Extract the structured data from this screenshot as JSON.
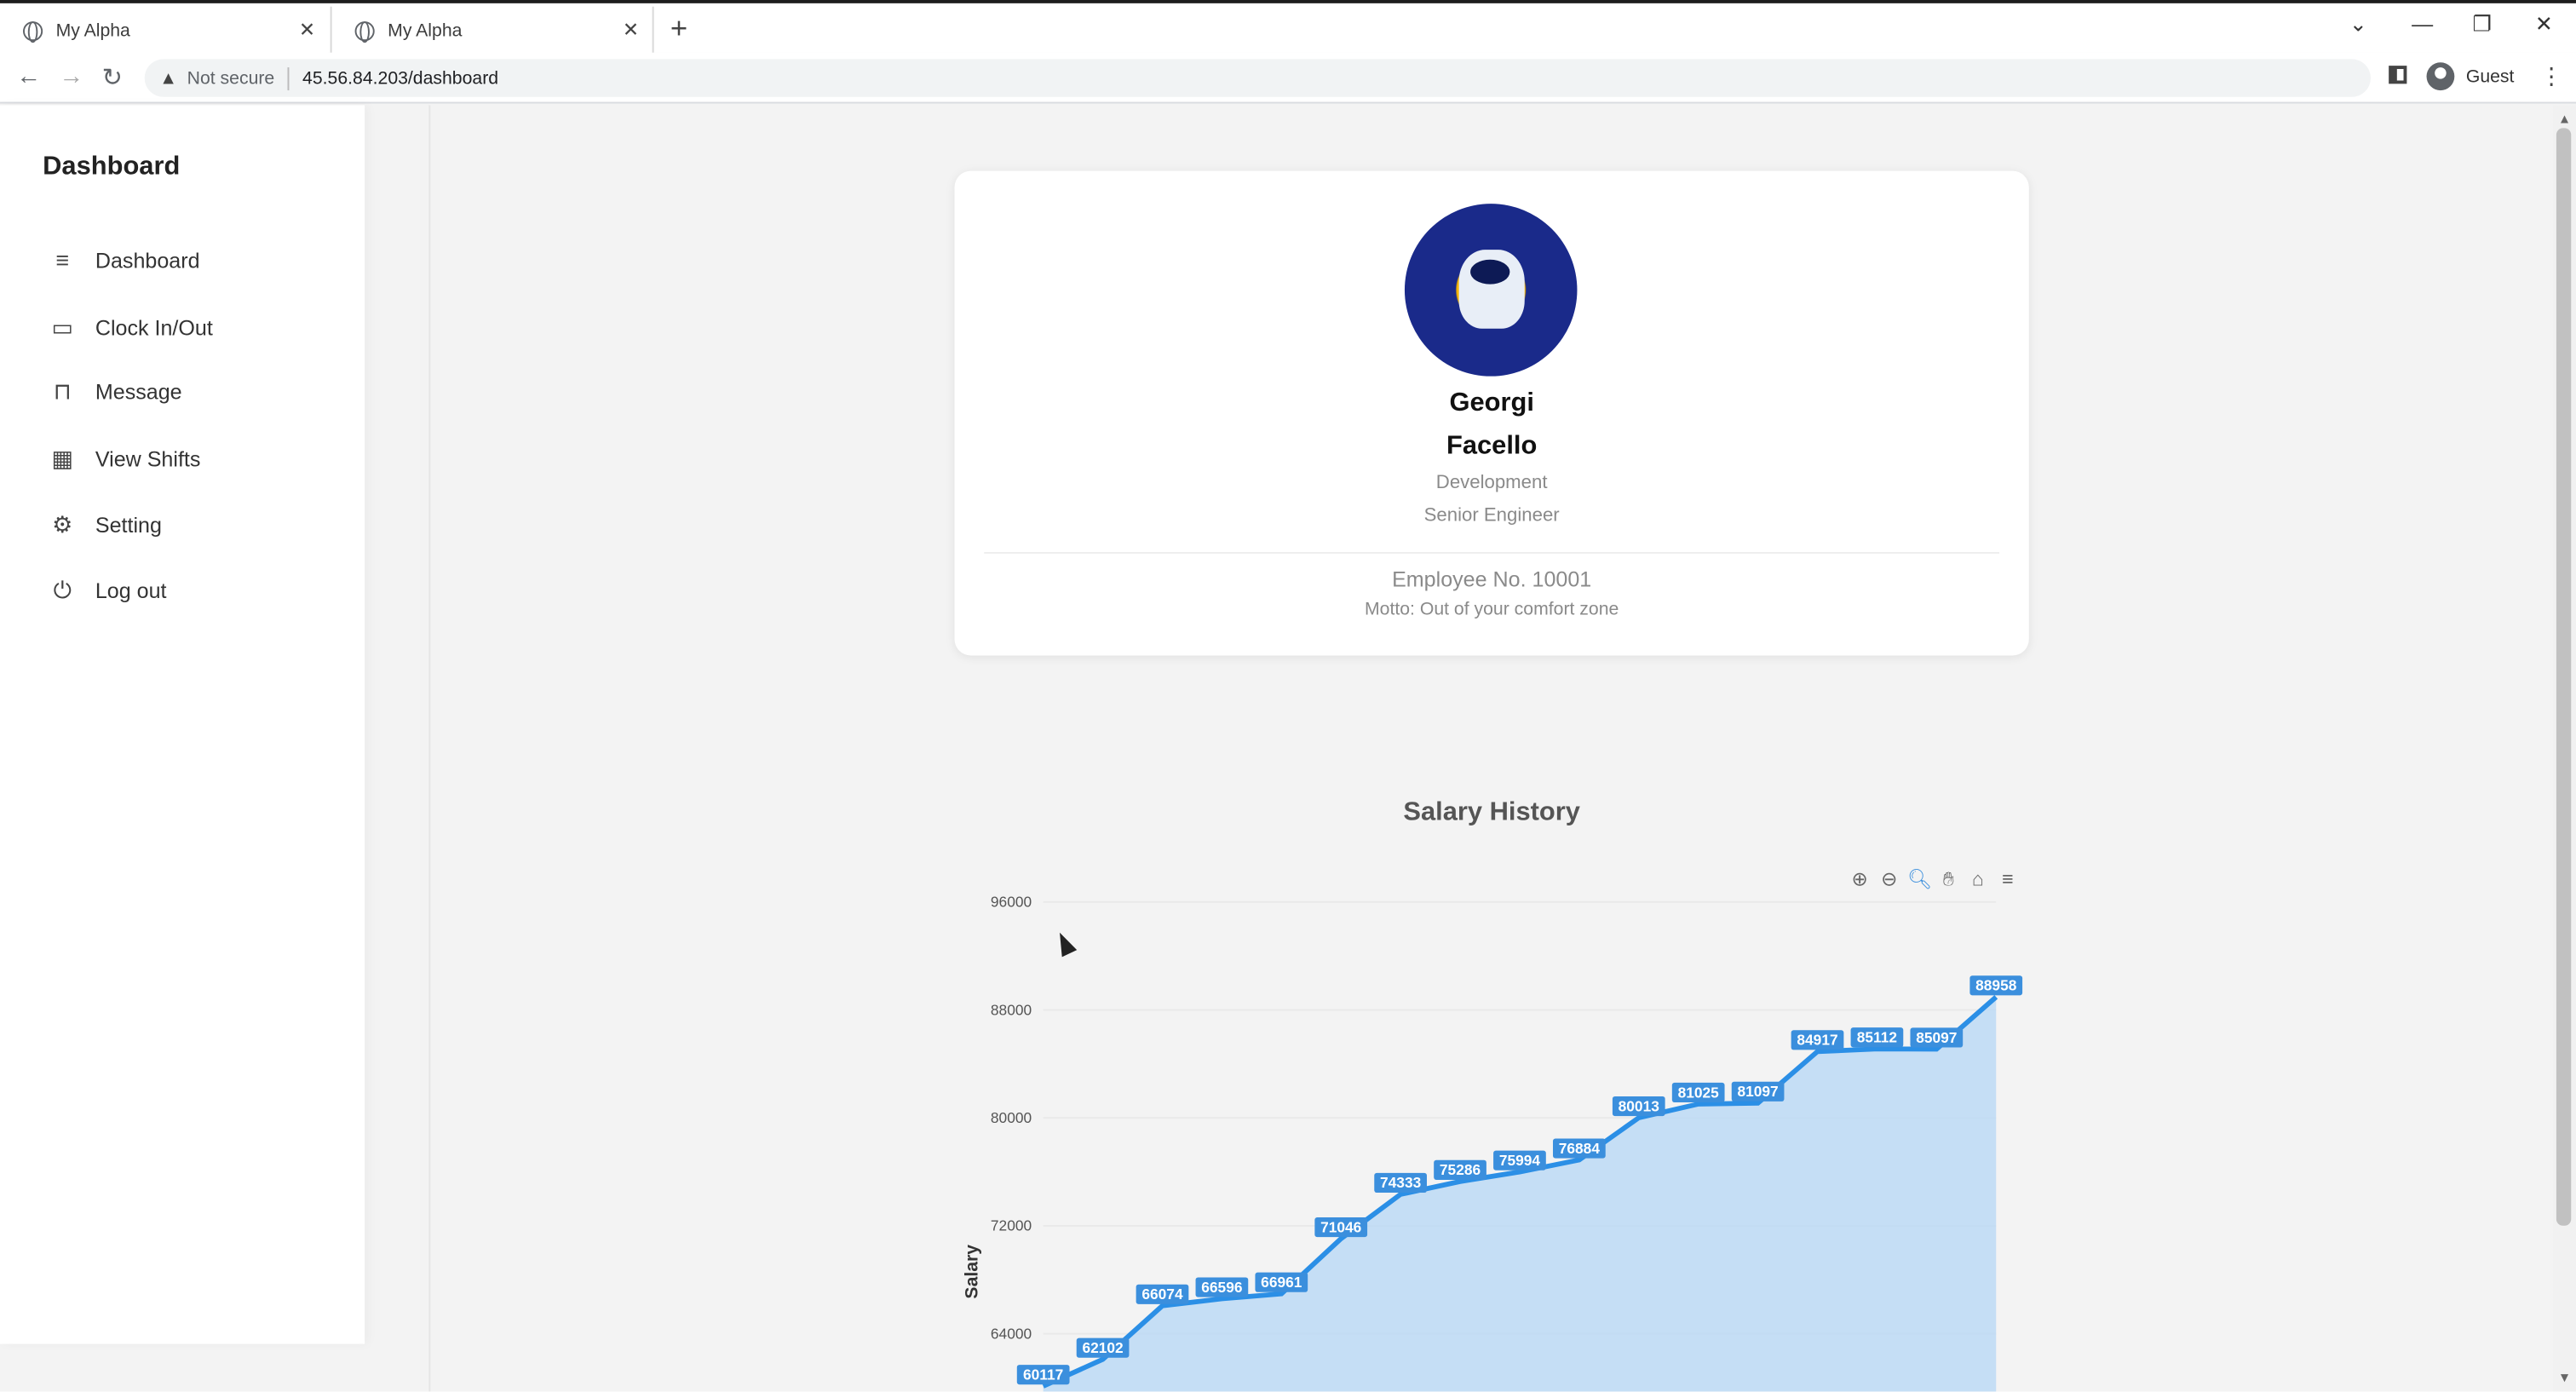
{
  "browser": {
    "tabs": [
      {
        "title": "My Alpha"
      },
      {
        "title": "My Alpha"
      }
    ],
    "security_label": "Not secure",
    "url": "45.56.84.203/dashboard",
    "profile": "Guest"
  },
  "sidebar": {
    "title": "Dashboard",
    "items": [
      {
        "label": "Dashboard",
        "icon": "menu-icon"
      },
      {
        "label": "Clock In/Out",
        "icon": "calendar-icon"
      },
      {
        "label": "Message",
        "icon": "inbox-icon"
      },
      {
        "label": "View Shifts",
        "icon": "calendar-grid-icon"
      },
      {
        "label": "Setting",
        "icon": "gear-icon"
      },
      {
        "label": "Log out",
        "icon": "power-icon"
      }
    ]
  },
  "profile": {
    "first_name": "Georgi",
    "last_name": "Facello",
    "department": "Development",
    "title": "Senior Engineer",
    "employee_no": "Employee No. 10001",
    "motto": "Motto: Out of your comfort zone"
  },
  "chart_data": {
    "type": "area",
    "title": "Salary History",
    "xlabel": "",
    "ylabel": "Salary",
    "ylim": [
      56000,
      96000
    ],
    "yticks": [
      64000,
      72000,
      80000,
      88000,
      96000
    ],
    "grid": true,
    "data_labels": true,
    "values": [
      60117,
      62102,
      66074,
      66596,
      66961,
      71046,
      74333,
      75286,
      75994,
      76884,
      80013,
      81025,
      81097,
      84917,
      85112,
      85097,
      88958
    ],
    "colors": {
      "line": "#2b8fe6",
      "fill": "#bcd9f5",
      "label_bg": "#3b8fdd",
      "label_text": "#ffffff"
    }
  }
}
